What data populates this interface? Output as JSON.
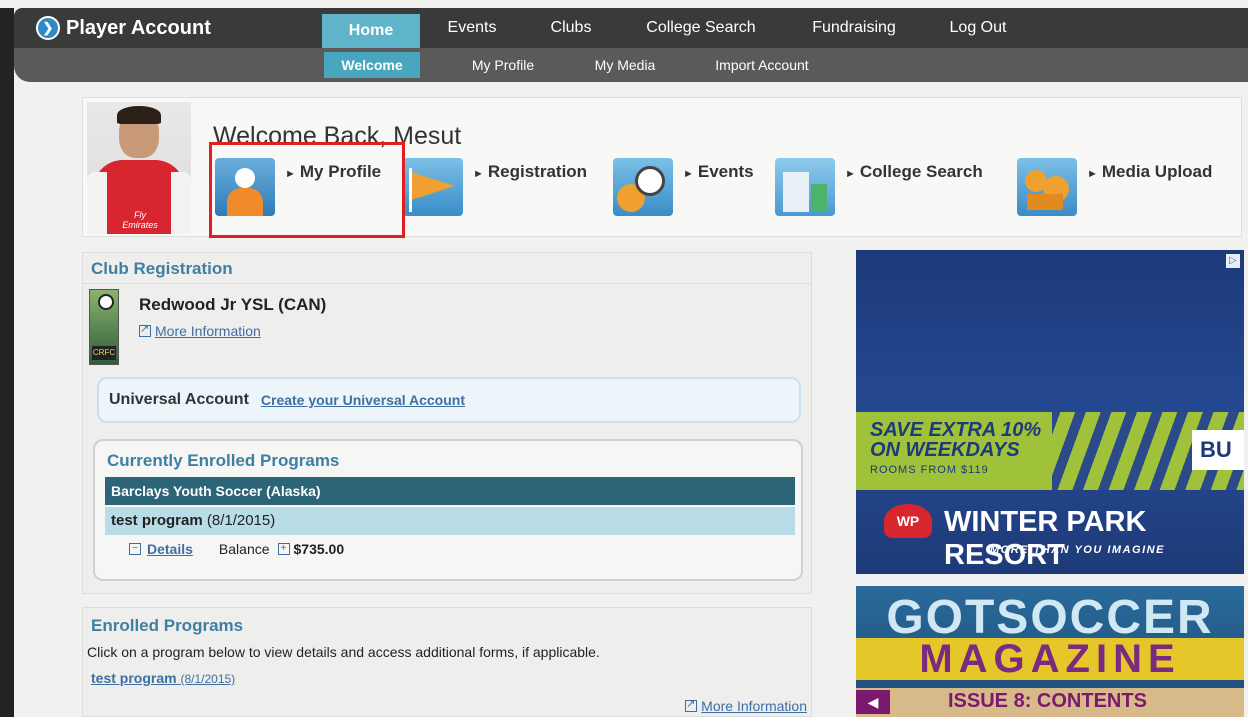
{
  "brand": {
    "title": "Player Account"
  },
  "nav": {
    "main": [
      "Home",
      "Events",
      "Clubs",
      "College Search",
      "Fundraising",
      "Log Out"
    ],
    "sub": [
      "Welcome",
      "My Profile",
      "My Media",
      "Import Account"
    ]
  },
  "welcome": {
    "title": "Welcome Back, Mesut",
    "links": [
      "My Profile",
      "Registration",
      "Events",
      "College Search",
      "Media Upload"
    ]
  },
  "club": {
    "title": "Club Registration",
    "name": "Redwood Jr YSL (CAN)",
    "more": "More Information"
  },
  "universal": {
    "label": "Universal Account",
    "link": "Create your Universal Account"
  },
  "current": {
    "title": "Currently Enrolled Programs",
    "org": "Barclays Youth Soccer (Alaska)",
    "program": "test program",
    "program_date": "(8/1/2015)",
    "details": "Details",
    "balance_label": "Balance",
    "balance": "$735.00"
  },
  "enrolled": {
    "title": "Enrolled Programs",
    "instructions": "Click on a program below to view details and access additional forms, if applicable.",
    "program": "test program",
    "program_date": "(8/1/2015)",
    "more": "More Information"
  },
  "ads": {
    "resort_save_line1": "SAVE EXTRA 10%",
    "resort_save_line2": "ON WEEKDAYS",
    "resort_rooms": "ROOMS FROM $119",
    "resort_button": "BU",
    "resort_logo": "WP",
    "resort_brand": "WINTER PARK RESORT",
    "resort_tagline": "MORE THAN YOU IMAGINE",
    "mag_title1": "GOTSOCCER",
    "mag_title2": "MAGAZINE",
    "mag_issue": "ISSUE 8: CONTENTS"
  },
  "colors": {
    "nav_active": "#5fb4c9",
    "link": "#3e6fa3",
    "section_title": "#3e7fa3",
    "table_header": "#2c6478",
    "table_row": "#b8dde6",
    "highlight": "#e02020"
  }
}
